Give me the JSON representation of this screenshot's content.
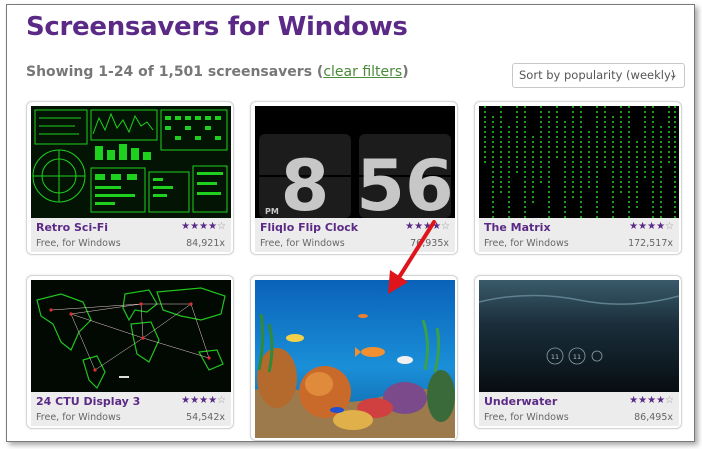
{
  "page": {
    "title": "Screensavers for Windows",
    "showing_text": "Showing 1-24 of 1,501 screensavers (",
    "clear_filters": "clear filters",
    "showing_close": ")",
    "sort_label": "Sort by popularity (weekly)"
  },
  "cards": [
    {
      "name": "Retro Sci-Fi",
      "meta": "Free, for Windows",
      "downloads": "84,921x",
      "stars": "★★★★",
      "empty": "☆",
      "rating": 4
    },
    {
      "name": "Fliqlo Flip Clock",
      "meta": "Free, for Windows",
      "downloads": "76,935x",
      "stars": "★★★★",
      "empty": "☆",
      "rating": 4,
      "clock_hour": "8",
      "clock_min": "56",
      "clock_ampm": "PM"
    },
    {
      "name": "The Matrix",
      "meta": "Free, for Windows",
      "downloads": "172,517x",
      "stars": "★★★★",
      "empty": "☆",
      "rating": 4
    },
    {
      "name": "24 CTU Display 3",
      "meta": "Free, for Windows",
      "downloads": "54,542x",
      "stars": "★★★★",
      "empty": "☆",
      "rating": 4
    },
    {
      "name": "",
      "meta": "",
      "downloads": "",
      "stars": "",
      "empty": "",
      "rating": null
    },
    {
      "name": "Underwater",
      "meta": "Free, for Windows",
      "downloads": "86,495x",
      "stars": "★★★★",
      "empty": "☆",
      "rating": 4,
      "clock_a": "11",
      "clock_b": "11"
    }
  ],
  "colors": {
    "brand": "#5b2a86",
    "link": "#4a8a3a",
    "arrow": "#e0141b"
  }
}
